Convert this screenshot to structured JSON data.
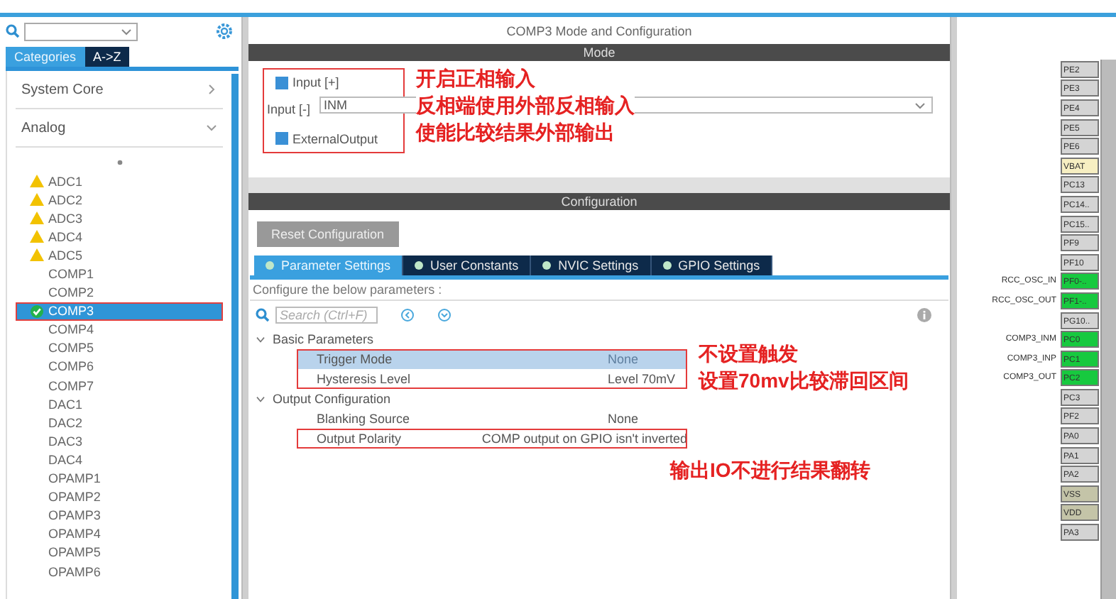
{
  "sidebar": {
    "tabs": [
      {
        "label": "Categories",
        "selected": true
      },
      {
        "label": "A->Z",
        "selected": false
      }
    ],
    "categories": [
      {
        "label": "System Core",
        "expanded": false
      },
      {
        "label": "Analog",
        "expanded": true
      }
    ],
    "items": [
      {
        "label": "ADC1",
        "kind": "warning",
        "selected": false
      },
      {
        "label": "ADC2",
        "kind": "warning",
        "selected": false
      },
      {
        "label": "ADC3",
        "kind": "warning",
        "selected": false
      },
      {
        "label": "ADC4",
        "kind": "warning",
        "selected": false
      },
      {
        "label": "ADC5",
        "kind": "warning",
        "selected": false
      },
      {
        "label": "COMP1",
        "kind": "plain",
        "selected": false
      },
      {
        "label": "COMP2",
        "kind": "plain",
        "selected": false
      },
      {
        "label": "COMP3",
        "kind": "enabled",
        "selected": true
      },
      {
        "label": "COMP4",
        "kind": "plain",
        "selected": false
      },
      {
        "label": "COMP5",
        "kind": "plain",
        "selected": false
      },
      {
        "label": "COMP6",
        "kind": "plain",
        "selected": false
      },
      {
        "label": "COMP7",
        "kind": "plain",
        "selected": false
      },
      {
        "label": "DAC1",
        "kind": "plain",
        "selected": false
      },
      {
        "label": "DAC2",
        "kind": "plain",
        "selected": false
      },
      {
        "label": "DAC3",
        "kind": "plain",
        "selected": false
      },
      {
        "label": "DAC4",
        "kind": "plain",
        "selected": false
      },
      {
        "label": "OPAMP1",
        "kind": "plain",
        "selected": false
      },
      {
        "label": "OPAMP2",
        "kind": "plain",
        "selected": false
      },
      {
        "label": "OPAMP3",
        "kind": "plain",
        "selected": false
      },
      {
        "label": "OPAMP4",
        "kind": "plain",
        "selected": false
      },
      {
        "label": "OPAMP5",
        "kind": "plain",
        "selected": false
      },
      {
        "label": "OPAMP6",
        "kind": "plain",
        "selected": false
      }
    ]
  },
  "main": {
    "title": "COMP3 Mode and Configuration",
    "mode": {
      "header": "Mode",
      "input_plus": {
        "label": "Input [+]",
        "checked": true
      },
      "input_minus": {
        "label": "Input [-]",
        "value": "INM"
      },
      "external_output": {
        "label": "ExternalOutput",
        "checked": true
      },
      "notes": [
        "开启正相输入",
        "反相端使用外部反相输入",
        "使能比较结果外部输出"
      ]
    },
    "configuration": {
      "header": "Configuration",
      "reset_button": "Reset Configuration",
      "tabs": [
        {
          "label": "Parameter Settings",
          "selected": true
        },
        {
          "label": "User Constants",
          "selected": false
        },
        {
          "label": "NVIC Settings",
          "selected": false
        },
        {
          "label": "GPIO Settings",
          "selected": false
        }
      ],
      "hint": "Configure the below parameters :",
      "search": {
        "placeholder": "Search (Ctrl+F)"
      },
      "groups": [
        {
          "label": "Basic Parameters",
          "blocks": [
            {
              "boxed": true,
              "notes": [
                "不设置触发",
                "设置70mv比较滞回区间"
              ],
              "rows": [
                {
                  "name": "Trigger Mode",
                  "value": "None",
                  "selected": true
                },
                {
                  "name": "Hysteresis Level",
                  "value": "Level 70mV",
                  "selected": false
                }
              ]
            }
          ]
        },
        {
          "label": "Output Configuration",
          "blocks": [
            {
              "boxed": false,
              "rows": [
                {
                  "name": "Blanking Source",
                  "value": "None",
                  "selected": false
                }
              ]
            },
            {
              "boxed": true,
              "notes": [
                "输出IO不进行结果翻转"
              ],
              "rows": [
                {
                  "name": "Output Polarity",
                  "value": "COMP output on GPIO isn't inverted",
                  "selected": false
                }
              ]
            }
          ]
        }
      ]
    }
  },
  "pins": [
    {
      "label": "PE2",
      "color": "#d4d4d4"
    },
    {
      "label": "PE3",
      "color": "#d4d4d4"
    },
    {
      "label": "PE4",
      "color": "#d4d4d4"
    },
    {
      "label": "PE5",
      "color": "#d4d4d4"
    },
    {
      "label": "PE6",
      "color": "#d4d4d4"
    },
    {
      "label": "VBAT",
      "color": "#f7efc2"
    },
    {
      "label": "PC13",
      "color": "#d4d4d4"
    },
    {
      "label": "PC14..",
      "color": "#d4d4d4"
    },
    {
      "label": "PC15..",
      "color": "#d4d4d4"
    },
    {
      "label": "PF9",
      "color": "#d4d4d4"
    },
    {
      "label": "PF10",
      "color": "#d4d4d4"
    },
    {
      "label": "PF0-..",
      "color": "#17c93f",
      "signal": "RCC_OSC_IN"
    },
    {
      "label": "PF1-..",
      "color": "#17c93f",
      "signal": "RCC_OSC_OUT"
    },
    {
      "label": "PG10..",
      "color": "#d4d4d4"
    },
    {
      "label": "PC0",
      "color": "#17c93f",
      "signal": "COMP3_INM"
    },
    {
      "label": "PC1",
      "color": "#17c93f",
      "signal": "COMP3_INP"
    },
    {
      "label": "PC2",
      "color": "#17c93f",
      "signal": "COMP3_OUT"
    },
    {
      "label": "PC3",
      "color": "#d4d4d4"
    },
    {
      "label": "PF2",
      "color": "#d4d4d4"
    },
    {
      "label": "PA0",
      "color": "#d4d4d4"
    },
    {
      "label": "PA1",
      "color": "#d4d4d4"
    },
    {
      "label": "PA2",
      "color": "#d4d4d4"
    },
    {
      "label": "VSS",
      "color": "#c4c4a8"
    },
    {
      "label": "VDD",
      "color": "#c4c4a8"
    },
    {
      "label": "PA3",
      "color": "#d4d4d4"
    }
  ]
}
